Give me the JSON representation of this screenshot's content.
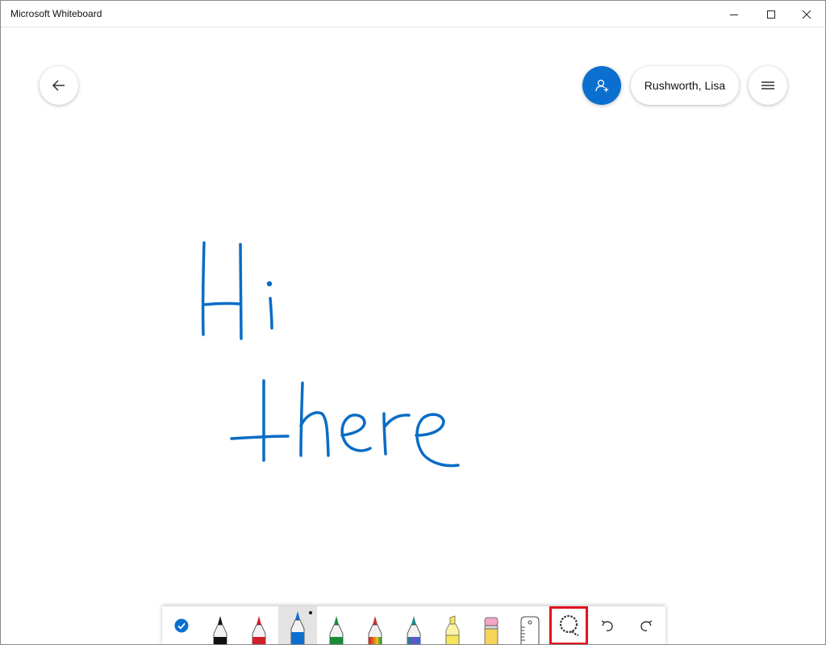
{
  "window": {
    "title": "Microsoft Whiteboard"
  },
  "header": {
    "user_name": "Rushworth, Lisa"
  },
  "ink_strokes_text": "Hi there",
  "colors": {
    "accent": "#0b6fd0",
    "ink": "#0a6cc4",
    "selection_highlight": "#e0141e"
  },
  "toolbar": {
    "tools": [
      {
        "name": "ink-to-shape-toggle",
        "icon": "check-circle-icon"
      },
      {
        "name": "black-pen",
        "icon": "pen-icon",
        "color": "#111111"
      },
      {
        "name": "red-pen",
        "icon": "pen-icon",
        "color": "#d1202a"
      },
      {
        "name": "blue-pen",
        "icon": "pen-icon",
        "color": "#0b6fd0",
        "selected": true
      },
      {
        "name": "green-pen",
        "icon": "pen-icon",
        "color": "#1b8a3a"
      },
      {
        "name": "rainbow-pen",
        "icon": "pen-icon",
        "color": "#e06a1c"
      },
      {
        "name": "galaxy-pen",
        "icon": "pen-icon",
        "color": "#1a8a8a"
      },
      {
        "name": "highlighter",
        "icon": "highlighter-icon",
        "color": "#f5e65a"
      },
      {
        "name": "eraser",
        "icon": "eraser-icon",
        "color": "#f3a6c6"
      },
      {
        "name": "ruler",
        "icon": "ruler-icon"
      },
      {
        "name": "lasso-select",
        "icon": "lasso-icon",
        "highlighted": true
      },
      {
        "name": "undo",
        "icon": "undo-icon"
      },
      {
        "name": "redo",
        "icon": "redo-icon"
      }
    ]
  }
}
